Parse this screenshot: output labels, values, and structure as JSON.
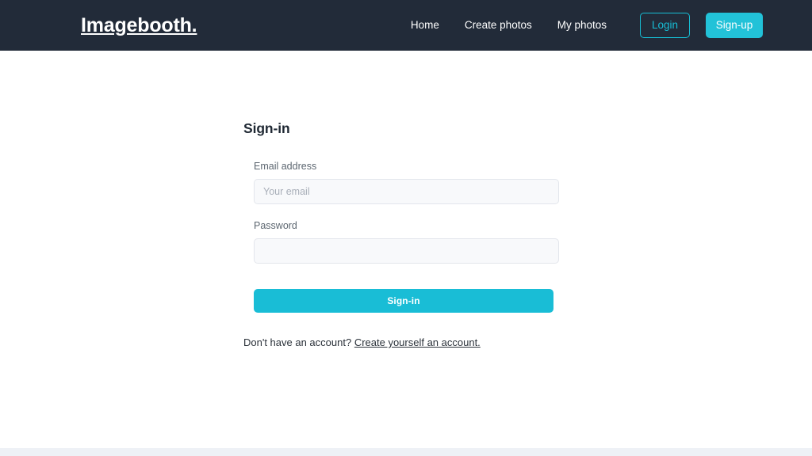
{
  "header": {
    "brand": "Imagebooth.",
    "nav_links": [
      {
        "label": "Home"
      },
      {
        "label": "Create photos"
      },
      {
        "label": "My photos"
      }
    ],
    "login_label": "Login",
    "signup_label": "Sign-up",
    "background_color": "#222b39",
    "accent_color": "#22c2d8"
  },
  "form": {
    "title": "Sign-in",
    "email": {
      "label": "Email address",
      "placeholder": "Your email",
      "value": ""
    },
    "password": {
      "label": "Password",
      "placeholder": "",
      "value": ""
    },
    "submit_label": "Sign-in",
    "submit_color": "#19bdd6",
    "footer_prompt": "Don't have an account? ",
    "footer_link": "Create yourself an account."
  },
  "footer": {
    "strip_color": "#eef1f6"
  }
}
